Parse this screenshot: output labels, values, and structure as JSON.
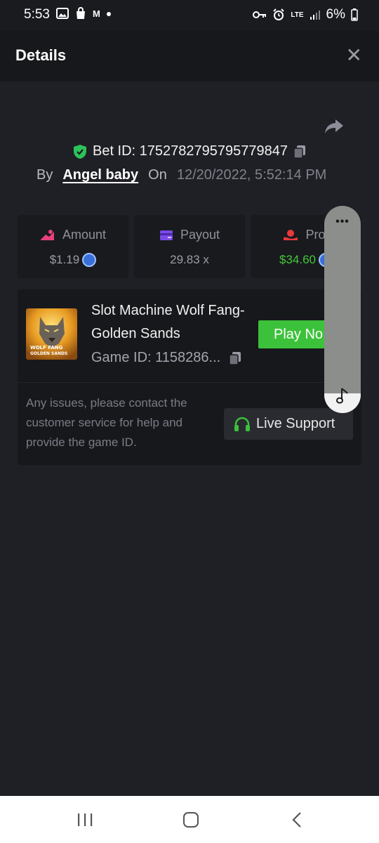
{
  "status_bar": {
    "time": "5:53",
    "carrier_icon_letter": "M",
    "network": "LTE",
    "battery": "6%"
  },
  "header": {
    "title": "Details"
  },
  "bet": {
    "id_text": "Bet ID: 1752782795795779847",
    "by_label": "By",
    "author": "Angel baby",
    "on_label": "On",
    "date": "12/20/2022, 5:52:14 PM"
  },
  "stats": [
    {
      "label": "Amount",
      "value": "$1.19",
      "color": "#e8407a"
    },
    {
      "label": "Payout",
      "value": "29.83 x",
      "color": "#7b4be8"
    },
    {
      "label": "Prof",
      "value": "$34.60",
      "color": "#e83a3a"
    }
  ],
  "game": {
    "title": "Slot Machine Wolf Fang- Golden Sands",
    "thumb_text_1": "WOLF FANG",
    "thumb_text_2": "GOLDEN SANDS",
    "game_id": "Game ID: 1158286...",
    "play_label": "Play No",
    "issue_text": "Any issues, please contact the customer service for help and provide the game ID.",
    "support_label": "Live Support"
  },
  "floating_bubble": {
    "more_glyph": "•••"
  },
  "colors": {
    "accent_green": "#3cc23a",
    "background": "#1f2025",
    "card": "#191a1e"
  },
  "icons": [
    "close-icon",
    "share-icon",
    "shield-icon",
    "copy-icon",
    "coin-icon",
    "headset-icon",
    "music-icon"
  ]
}
